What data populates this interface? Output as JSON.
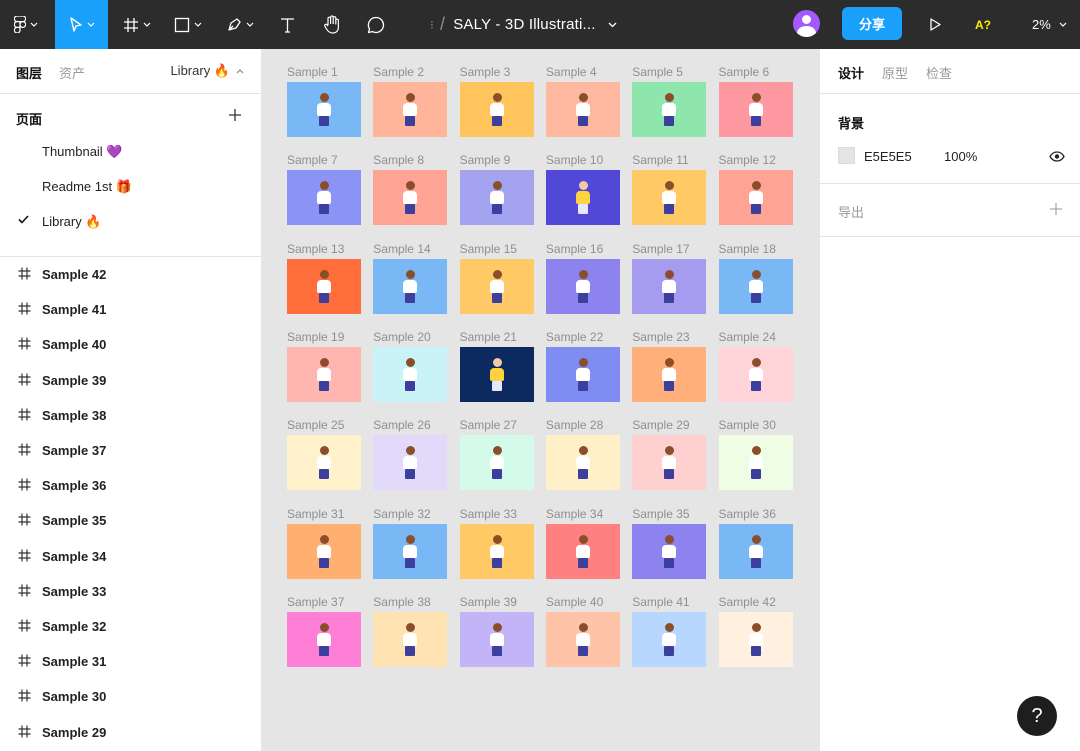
{
  "toolbar": {
    "document_title": "SALY - 3D Illustrati...",
    "share_label": "分享",
    "avatar_badge": "A?",
    "zoom_level": "2%"
  },
  "left_panel": {
    "tabs": {
      "layers": "图层",
      "assets": "资产"
    },
    "library_label": "Library 🔥",
    "pages_title": "页面",
    "pages": [
      "Thumbnail 💜",
      "Readme 1st 🎁",
      "Library 🔥"
    ],
    "layers": [
      "Sample 42",
      "Sample 41",
      "Sample 40",
      "Sample 39",
      "Sample 38",
      "Sample 37",
      "Sample 36",
      "Sample 35",
      "Sample 34",
      "Sample 33",
      "Sample 32",
      "Sample 31",
      "Sample 30",
      "Sample 29"
    ]
  },
  "canvas": {
    "frames": [
      {
        "name": "Sample 1",
        "bg": "#7ab8f5"
      },
      {
        "name": "Sample 2",
        "bg": "#ffb59a"
      },
      {
        "name": "Sample 3",
        "bg": "#ffc45c"
      },
      {
        "name": "Sample 4",
        "bg": "#ffb8a0"
      },
      {
        "name": "Sample 5",
        "bg": "#8fe6ad"
      },
      {
        "name": "Sample 6",
        "bg": "#ff99a1"
      },
      {
        "name": "Sample 7",
        "bg": "#8b93f5"
      },
      {
        "name": "Sample 8",
        "bg": "#ffa494"
      },
      {
        "name": "Sample 9",
        "bg": "#a3a3f0"
      },
      {
        "name": "Sample 10",
        "bg": "#5148d8"
      },
      {
        "name": "Sample 11",
        "bg": "#ffc966"
      },
      {
        "name": "Sample 12",
        "bg": "#ffa494"
      },
      {
        "name": "Sample 13",
        "bg": "#ff6d3b"
      },
      {
        "name": "Sample 14",
        "bg": "#7ab8f5"
      },
      {
        "name": "Sample 15",
        "bg": "#ffc966"
      },
      {
        "name": "Sample 16",
        "bg": "#8c83ef"
      },
      {
        "name": "Sample 17",
        "bg": "#a59cf0"
      },
      {
        "name": "Sample 18",
        "bg": "#7ab8f5"
      },
      {
        "name": "Sample 19",
        "bg": "#ffb5b0"
      },
      {
        "name": "Sample 20",
        "bg": "#c9f3f7"
      },
      {
        "name": "Sample 21",
        "bg": "#0d2a60"
      },
      {
        "name": "Sample 22",
        "bg": "#7f8cf2"
      },
      {
        "name": "Sample 23",
        "bg": "#ffb07a"
      },
      {
        "name": "Sample 24",
        "bg": "#ffd4d8"
      },
      {
        "name": "Sample 25",
        "bg": "#fff1cc"
      },
      {
        "name": "Sample 26",
        "bg": "#e3d9fb"
      },
      {
        "name": "Sample 27",
        "bg": "#d4fae9"
      },
      {
        "name": "Sample 28",
        "bg": "#fff0c7"
      },
      {
        "name": "Sample 29",
        "bg": "#ffd0d0"
      },
      {
        "name": "Sample 30",
        "bg": "#eefde4"
      },
      {
        "name": "Sample 31",
        "bg": "#ffb070"
      },
      {
        "name": "Sample 32",
        "bg": "#7ab8f5"
      },
      {
        "name": "Sample 33",
        "bg": "#ffc966"
      },
      {
        "name": "Sample 34",
        "bg": "#ff8080"
      },
      {
        "name": "Sample 35",
        "bg": "#8c83ef"
      },
      {
        "name": "Sample 36",
        "bg": "#7ab8f5"
      },
      {
        "name": "Sample 37",
        "bg": "#ff7ed6"
      },
      {
        "name": "Sample 38",
        "bg": "#ffe3b3"
      },
      {
        "name": "Sample 39",
        "bg": "#c3b3f7"
      },
      {
        "name": "Sample 40",
        "bg": "#ffc4a8"
      },
      {
        "name": "Sample 41",
        "bg": "#b8d7ff"
      },
      {
        "name": "Sample 42",
        "bg": "#fff0e0"
      }
    ]
  },
  "right_panel": {
    "tabs": [
      "设计",
      "原型",
      "检查"
    ],
    "background_title": "背景",
    "bg_hex": "E5E5E5",
    "bg_opacity": "100%",
    "export_label": "导出"
  },
  "help_label": "?",
  "colors": {
    "toolbar": "#2c2c2c",
    "accent": "#18a0fb",
    "canvas": "#e5e5e5"
  }
}
